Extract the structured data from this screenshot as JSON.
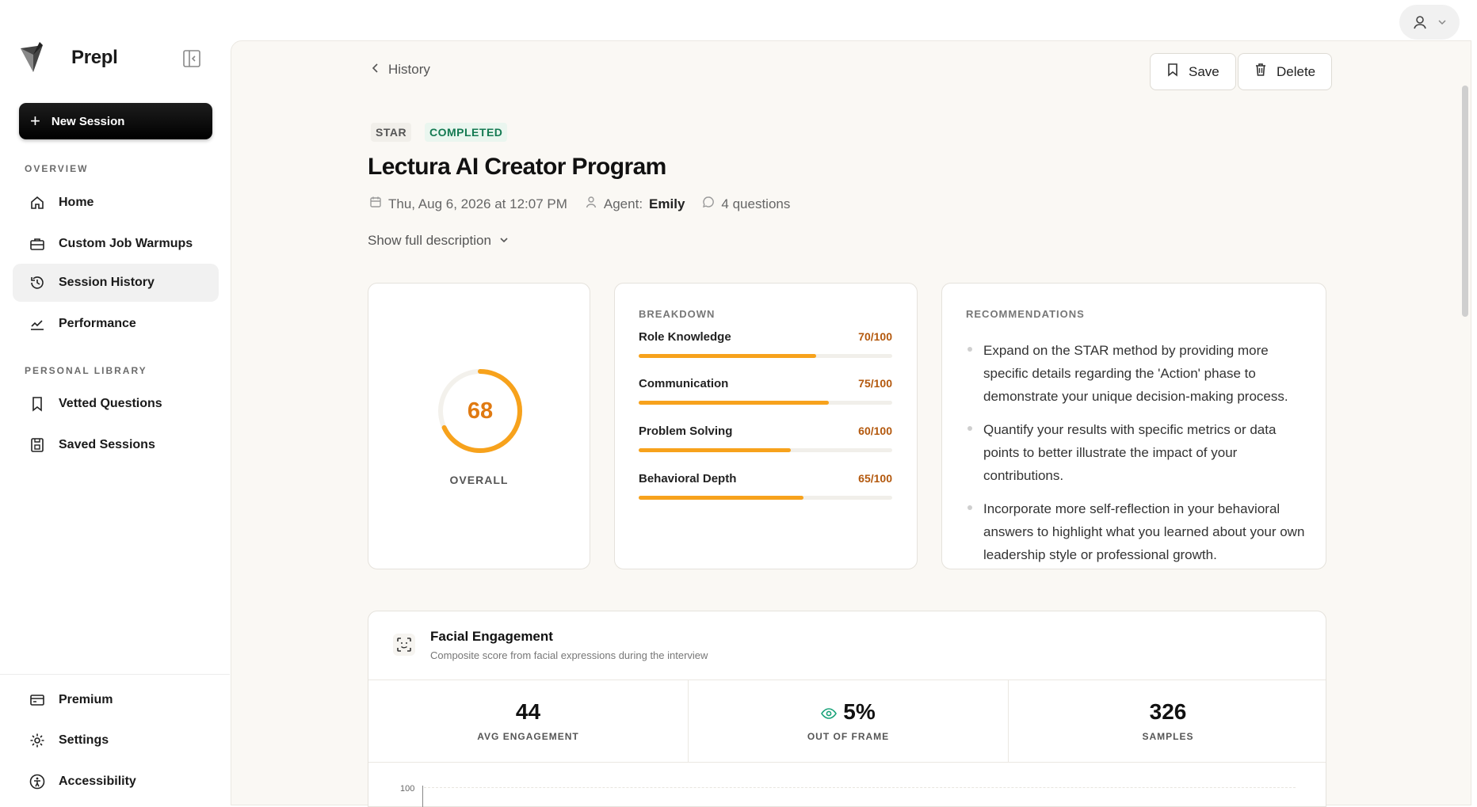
{
  "app": {
    "name": "Prepl"
  },
  "sidebar": {
    "new_session_label": "New Session",
    "overview_label": "OVERVIEW",
    "overview_items": [
      {
        "label": "Home",
        "icon": "home-icon"
      },
      {
        "label": "Custom Job Warmups",
        "icon": "briefcase-icon"
      },
      {
        "label": "Session History",
        "icon": "history-icon",
        "active": true
      },
      {
        "label": "Performance",
        "icon": "chart-line-icon"
      }
    ],
    "library_label": "PERSONAL LIBRARY",
    "library_items": [
      {
        "label": "Vetted Questions",
        "icon": "bookmark-icon"
      },
      {
        "label": "Saved Sessions",
        "icon": "save-icon"
      }
    ],
    "footer_items": [
      {
        "label": "Premium",
        "icon": "card-icon"
      },
      {
        "label": "Settings",
        "icon": "gear-icon"
      },
      {
        "label": "Accessibility",
        "icon": "accessibility-icon"
      }
    ]
  },
  "header": {
    "back_label": "History",
    "save_label": "Save",
    "delete_label": "Delete"
  },
  "session": {
    "tag_type": "STAR",
    "tag_status": "COMPLETED",
    "title": "Lectura AI Creator Program",
    "date": "Thu, Aug 6, 2026 at 12:07 PM",
    "agent_label": "Agent:",
    "agent_name": "Emily",
    "questions": "4 questions",
    "show_description": "Show full description"
  },
  "overall": {
    "score": "68",
    "score_fraction": 0.68,
    "label": "OVERALL"
  },
  "breakdown": {
    "label": "BREAKDOWN",
    "items": [
      {
        "name": "Role Knowledge",
        "score": "70/100",
        "value": 70
      },
      {
        "name": "Communication",
        "score": "75/100",
        "value": 75
      },
      {
        "name": "Problem Solving",
        "score": "60/100",
        "value": 60
      },
      {
        "name": "Behavioral Depth",
        "score": "65/100",
        "value": 65
      }
    ]
  },
  "recommendations": {
    "label": "RECOMMENDATIONS",
    "items": [
      "Expand on the STAR method by providing more specific details regarding the 'Action' phase to demonstrate your unique decision-making process.",
      "Quantify your results with specific metrics or data points to better illustrate the impact of your contributions.",
      "Incorporate more self-reflection in your behavioral answers to highlight what you learned about your own leadership style or professional growth."
    ]
  },
  "facial": {
    "title": "Facial Engagement",
    "subtitle": "Composite score from facial expressions during the interview",
    "avg_engagement_value": "44",
    "avg_engagement_label": "AVG ENGAGEMENT",
    "out_of_frame_value": "5%",
    "out_of_frame_label": "OUT OF FRAME",
    "samples_value": "326",
    "samples_label": "SAMPLES",
    "axis_max": "100"
  },
  "colors": {
    "accent": "#f7a21c",
    "score_text": "#e07a12",
    "status_green": "#147a52",
    "eye_icon": "#1aa37a"
  }
}
